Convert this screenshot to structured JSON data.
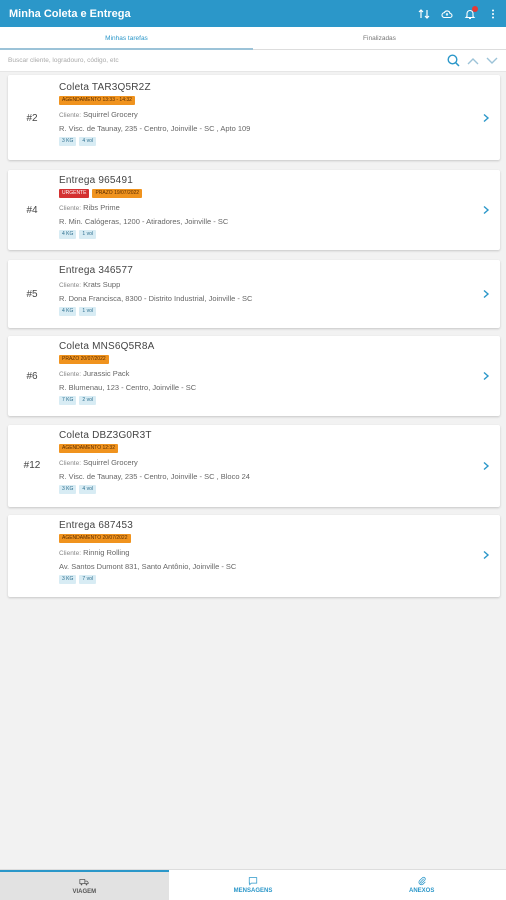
{
  "app": {
    "title": "Minha Coleta e Entrega",
    "brand_color": "#2b97c9",
    "header_icons": [
      "swap-icon",
      "cloud-icon",
      "bell-icon",
      "more-icon"
    ]
  },
  "tabs": [
    {
      "label": "Minhas tarefas",
      "active": true
    },
    {
      "label": "Finalizadas",
      "active": false
    }
  ],
  "search": {
    "placeholder": "Buscar cliente, logradouro, código, etc"
  },
  "cards": [
    {
      "index": "#2",
      "title": "Coleta TAR3Q5R2Z",
      "badges": [
        {
          "text": "AGENDAMENTO 13:33 - 14:32",
          "color": "orange"
        }
      ],
      "client_label": "Cliente:",
      "client": "Squirrel Grocery",
      "address": "R. Visc. de Taunay, 235 - Centro, Joinville - SC , Apto 109",
      "tags": [
        "3 KG",
        "4 vol"
      ]
    },
    {
      "index": "#4",
      "title": "Entrega 965491",
      "badges": [
        {
          "text": "URGENTE",
          "color": "red"
        },
        {
          "text": "PRAZO 19/07/2022",
          "color": "orange"
        }
      ],
      "client_label": "Cliente:",
      "client": "Ribs Prime",
      "address": "R. Min. Calógeras, 1200 - Atiradores, Joinville - SC",
      "tags": [
        "4 KG",
        "1 vol"
      ]
    },
    {
      "index": "#5",
      "title": "Entrega 346577",
      "badges": [],
      "client_label": "Cliente:",
      "client": "Krats Supp",
      "address": "R. Dona Francisca, 8300 - Distrito Industrial, Joinville - SC",
      "tags": [
        "4 KG",
        "1 vol"
      ]
    },
    {
      "index": "#6",
      "title": "Coleta MNS6Q5R8A",
      "badges": [
        {
          "text": "PRAZO 20/07/2022",
          "color": "orange"
        }
      ],
      "client_label": "Cliente:",
      "client": "Jurassic Pack",
      "address": "R. Blumenau, 123 - Centro, Joinville - SC",
      "tags": [
        "7 KG",
        "2 vol"
      ]
    },
    {
      "index": "#12",
      "title": "Coleta DBZ3G0R3T",
      "badges": [
        {
          "text": "AGENDAMENTO 12:32",
          "color": "orange"
        }
      ],
      "client_label": "Cliente:",
      "client": "Squirrel Grocery",
      "address": "R. Visc. de Taunay, 235 - Centro, Joinville - SC , Bloco 24",
      "tags": [
        "3 KG",
        "4 vol"
      ]
    },
    {
      "index": "",
      "title": "Entrega 687453",
      "badges": [
        {
          "text": "AGENDAMENTO 20/07/2022",
          "color": "orange"
        }
      ],
      "client_label": "Cliente:",
      "client": "Rinnig Rolling",
      "address": "Av. Santos Dumont 831, Santo Antônio, Joinville - SC",
      "tags": [
        "3 KG",
        "7 vol"
      ]
    }
  ],
  "bottom_nav": [
    {
      "label": "VIAGEM",
      "icon": "truck-icon",
      "active": true
    },
    {
      "label": "MENSAGENS",
      "icon": "chat-icon",
      "active": false
    },
    {
      "label": "ANEXOS",
      "icon": "paperclip-icon",
      "active": false
    }
  ]
}
